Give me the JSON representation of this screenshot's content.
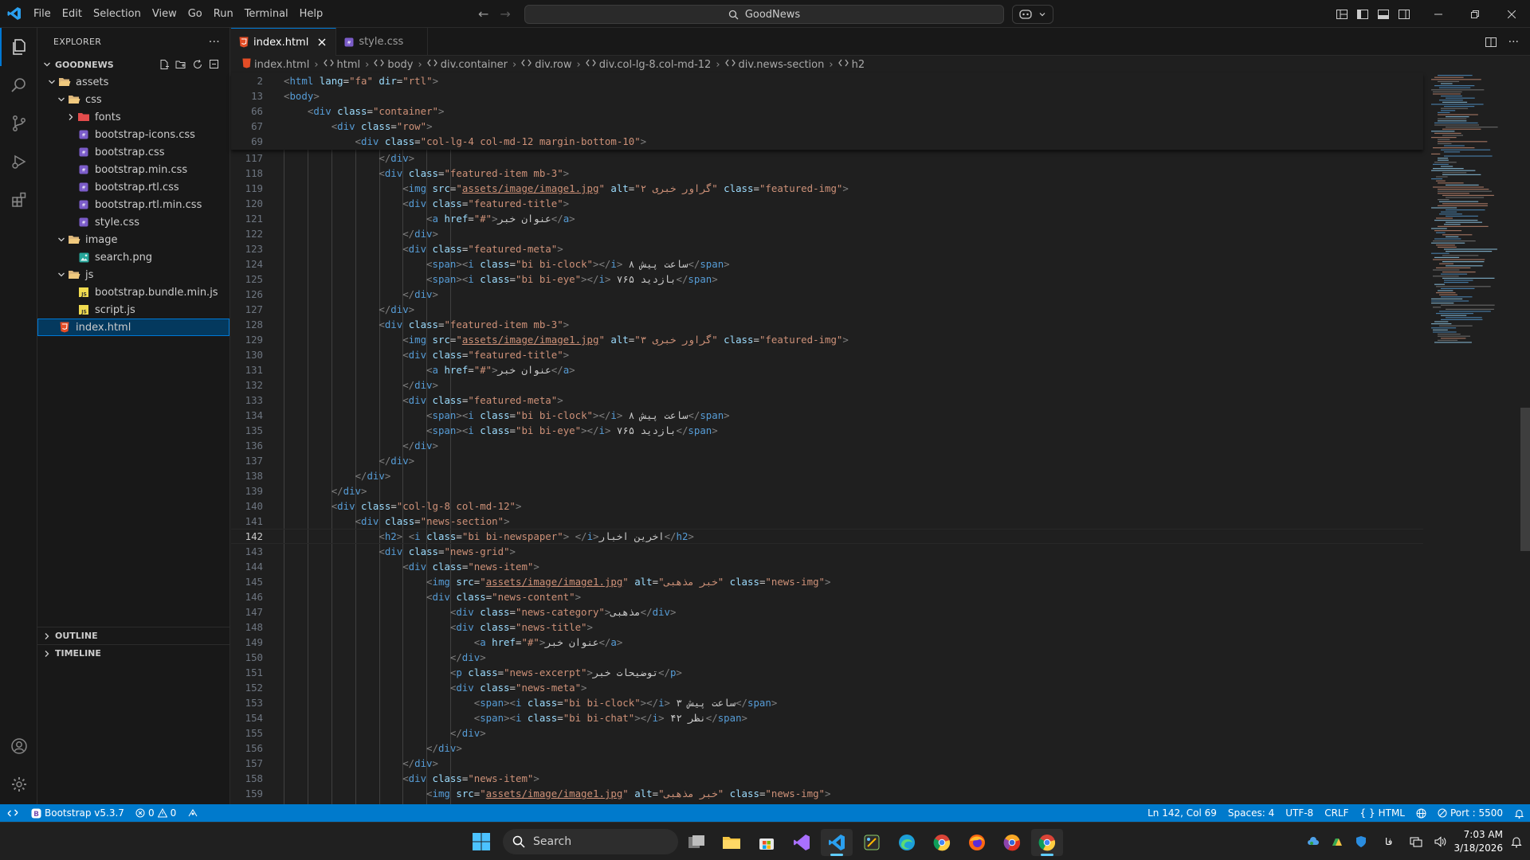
{
  "titlebar": {
    "menu": [
      "File",
      "Edit",
      "Selection",
      "View",
      "Go",
      "Run",
      "Terminal",
      "Help"
    ],
    "search_text": "GoodNews"
  },
  "sidebar": {
    "title": "EXPLORER",
    "more": "···",
    "root": "GOODNEWS",
    "tree": [
      {
        "label": "assets",
        "kind": "folder-open"
      },
      {
        "label": "css",
        "kind": "folder-open"
      },
      {
        "label": "fonts",
        "kind": "folder-closed"
      },
      {
        "label": "bootstrap-icons.css",
        "kind": "css"
      },
      {
        "label": "bootstrap.css",
        "kind": "css"
      },
      {
        "label": "bootstrap.min.css",
        "kind": "css"
      },
      {
        "label": "bootstrap.rtl.css",
        "kind": "css"
      },
      {
        "label": "bootstrap.rtl.min.css",
        "kind": "css"
      },
      {
        "label": "style.css",
        "kind": "css"
      },
      {
        "label": "image",
        "kind": "folder-open"
      },
      {
        "label": "search.png",
        "kind": "image"
      },
      {
        "label": "js",
        "kind": "folder-open"
      },
      {
        "label": "bootstrap.bundle.min.js",
        "kind": "js"
      },
      {
        "label": "script.js",
        "kind": "js"
      },
      {
        "label": "index.html",
        "kind": "html"
      }
    ],
    "outline": "OUTLINE",
    "timeline": "TIMELINE"
  },
  "tabs": [
    {
      "label": "index.html",
      "active": true
    },
    {
      "label": "style.css",
      "active": false
    }
  ],
  "breadcrumbs": [
    "index.html",
    "html",
    "body",
    "div.container",
    "div.row",
    "div.col-lg-8.col-md-12",
    "div.news-section",
    "h2"
  ],
  "editor": {
    "sticky": [
      {
        "n": "2",
        "text": "<html lang=\"fa\" dir=\"rtl\">"
      },
      {
        "n": "13",
        "text": "<body>"
      },
      {
        "n": "66",
        "text": "    <div class=\"container\">"
      },
      {
        "n": "67",
        "text": "        <div class=\"row\">"
      },
      {
        "n": "69",
        "text": "            <div class=\"col-lg-4 col-md-12 margin-bottom-10\">"
      }
    ],
    "lines": [
      {
        "n": "117",
        "text": "                </div>"
      },
      {
        "n": "118",
        "text": "                <div class=\"featured-item mb-3\">"
      },
      {
        "n": "119",
        "text": "                    <img src=\"assets/image/image1.jpg\" alt=\"گراور خبری ۲\" class=\"featured-img\">"
      },
      {
        "n": "120",
        "text": "                    <div class=\"featured-title\">"
      },
      {
        "n": "121",
        "text": "                        <a href=\"#\">عنوان خبر</a>"
      },
      {
        "n": "122",
        "text": "                    </div>"
      },
      {
        "n": "123",
        "text": "                    <div class=\"featured-meta\">"
      },
      {
        "n": "124",
        "text": "                        <span><i class=\"bi bi-clock\"></i> ۸ ساعت پیش</span>"
      },
      {
        "n": "125",
        "text": "                        <span><i class=\"bi bi-eye\"></i> ۷۶۵ بازدید</span>"
      },
      {
        "n": "126",
        "text": "                    </div>"
      },
      {
        "n": "127",
        "text": "                </div>"
      },
      {
        "n": "128",
        "text": "                <div class=\"featured-item mb-3\">"
      },
      {
        "n": "129",
        "text": "                    <img src=\"assets/image/image1.jpg\" alt=\"گراور خبری ۳\" class=\"featured-img\">"
      },
      {
        "n": "130",
        "text": "                    <div class=\"featured-title\">"
      },
      {
        "n": "131",
        "text": "                        <a href=\"#\">عنوان خبر</a>"
      },
      {
        "n": "132",
        "text": "                    </div>"
      },
      {
        "n": "133",
        "text": "                    <div class=\"featured-meta\">"
      },
      {
        "n": "134",
        "text": "                        <span><i class=\"bi bi-clock\"></i> ۸ ساعت پیش</span>"
      },
      {
        "n": "135",
        "text": "                        <span><i class=\"bi bi-eye\"></i> ۷۶۵ بازدید</span>"
      },
      {
        "n": "136",
        "text": "                    </div>"
      },
      {
        "n": "137",
        "text": "                </div>"
      },
      {
        "n": "138",
        "text": "            </div>"
      },
      {
        "n": "139",
        "text": "        </div>"
      },
      {
        "n": "140",
        "text": "        <div class=\"col-lg-8 col-md-12\">"
      },
      {
        "n": "141",
        "text": "            <div class=\"news-section\">"
      },
      {
        "n": "142",
        "text": "                <h2> <i class=\"bi bi-newspaper\"> </i>اخرین اخبار</h2>"
      },
      {
        "n": "143",
        "text": "                <div class=\"news-grid\">"
      },
      {
        "n": "144",
        "text": "                    <div class=\"news-item\">"
      },
      {
        "n": "145",
        "text": "                        <img src=\"assets/image/image1.jpg\" alt=\"خبر مذهبی\" class=\"news-img\">"
      },
      {
        "n": "146",
        "text": "                        <div class=\"news-content\">"
      },
      {
        "n": "147",
        "text": "                            <div class=\"news-category\">مذهبی</div>"
      },
      {
        "n": "148",
        "text": "                            <div class=\"news-title\">"
      },
      {
        "n": "149",
        "text": "                                <a href=\"#\">عنوان خبر</a>"
      },
      {
        "n": "150",
        "text": "                            </div>"
      },
      {
        "n": "151",
        "text": "                            <p class=\"news-excerpt\">توضیحات خبر</p>"
      },
      {
        "n": "152",
        "text": "                            <div class=\"news-meta\">"
      },
      {
        "n": "153",
        "text": "                                <span><i class=\"bi bi-clock\"></i> ۳ ساعت پیش</span>"
      },
      {
        "n": "154",
        "text": "                                <span><i class=\"bi bi-chat\"></i> ۴۲ نظر</span>"
      },
      {
        "n": "155",
        "text": "                            </div>"
      },
      {
        "n": "156",
        "text": "                        </div>"
      },
      {
        "n": "157",
        "text": "                    </div>"
      },
      {
        "n": "158",
        "text": "                    <div class=\"news-item\">"
      },
      {
        "n": "159",
        "text": "                        <img src=\"assets/image/image1.jpg\" alt=\"خبر مذهبی\" class=\"news-img\">"
      }
    ],
    "current_line": "142"
  },
  "statusbar": {
    "bootstrap": "Bootstrap v5.3.7",
    "errors": "0",
    "warnings": "0",
    "position": "Ln 142, Col 69",
    "spaces": "Spaces: 4",
    "encoding": "UTF-8",
    "eol": "CRLF",
    "language": "HTML",
    "port": "Port : 5500"
  },
  "taskbar": {
    "search": "Search",
    "lang": "فا",
    "time": "7:03 AM",
    "date": "3/18/2026"
  },
  "colors": {
    "accent": "#0078d4",
    "statusbar": "#007acc",
    "tag": "#569cd6",
    "attr": "#9cdcfe",
    "string": "#ce9178"
  }
}
